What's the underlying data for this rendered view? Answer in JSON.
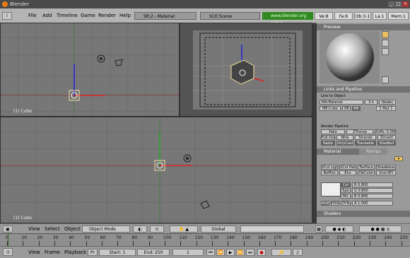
{
  "window": {
    "title": "Blender"
  },
  "menubar": {
    "menus": [
      "File",
      "Add",
      "Timeline",
      "Game",
      "Render",
      "Help"
    ],
    "screen_selector": "SR:2 - Material",
    "scene_selector": "SCE:Scene",
    "website": "www.blender.org 249.2",
    "stats": [
      "Ve:8",
      "Fa:6",
      "Ob:3-1",
      "La:1",
      "Mem:1"
    ]
  },
  "viewports": {
    "top_left_label": "(1) Cube",
    "bottom_label": "(1) Cube"
  },
  "view_header": {
    "menus": [
      "View",
      "Select",
      "Object"
    ],
    "mode": "Object Mode",
    "pivot": "Global"
  },
  "properties": {
    "preview_title": "Preview",
    "links_title": "Links and Pipeline",
    "link_to_object": "Link to Object",
    "material_field": "MA:Material",
    "nodes_btn": "Nodes",
    "me_cube": "ME:Cube",
    "ob_btn": "OB",
    "me_btn": "ME",
    "mat_count": "1 Mat 1",
    "render_pipeline_title": "Render Pipeline",
    "pipeline_buttons": [
      "Halo",
      "ZTransp",
      "Zoffs: 0.000",
      "Full Osa",
      "Wire",
      "Strands",
      "Zinvert",
      "Radio",
      "OnlyCast",
      "Traceable",
      "Shadbuf"
    ],
    "material_tab": "Material",
    "ramps_tab": "Ramps",
    "material_buttons": [
      "VCol Light",
      "VCol Paint",
      "TexFace",
      "Shadeless",
      "NoMist",
      "Env",
      "ObColor",
      "Vcol-ATI"
    ],
    "col_label": "Col",
    "spe_label": "Spe",
    "mir_label": "Mir",
    "r_value": "R 0.800",
    "g_value": "G 0.800",
    "b_value": "B 0.800",
    "color_model": [
      "RGB",
      "HSV",
      "DYN"
    ],
    "alpha_value": "A 1.000",
    "shaders_title": "Shaders"
  },
  "ruler": {
    "ticks": [
      "0",
      "10",
      "20",
      "30",
      "40",
      "50",
      "60",
      "70",
      "80",
      "90",
      "100",
      "110",
      "120",
      "130",
      "140",
      "150",
      "160",
      "170",
      "180",
      "190",
      "200",
      "210",
      "220",
      "230",
      "240",
      "250"
    ]
  },
  "timeline": {
    "menus": [
      "View",
      "Frame",
      "Playback"
    ],
    "pr": "Pr",
    "start": "Start: 1",
    "end": "End: 250",
    "current_frame": "1"
  },
  "colors": {
    "accent_orange": "#e87d0d",
    "url_green": "#2e8a1f",
    "grid_bg": "#777777"
  }
}
